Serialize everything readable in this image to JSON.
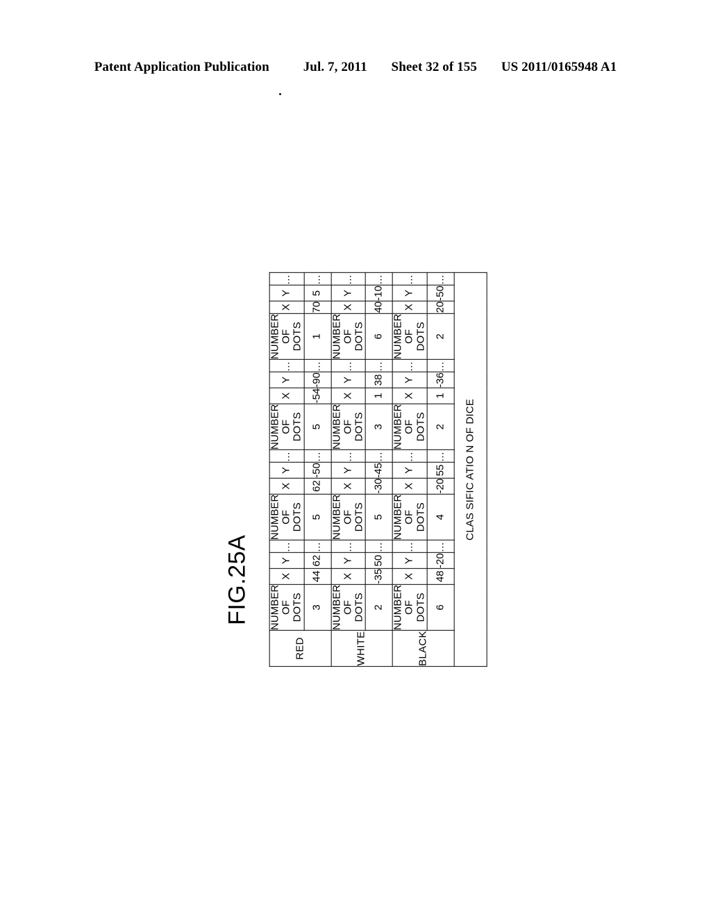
{
  "page_header": {
    "publication": "Patent Application Publication",
    "date": "Jul. 7, 2011",
    "sheet": "Sheet 32 of 155",
    "doc_number": "US 2011/0165948 A1"
  },
  "figure": {
    "label": "FIG.25A",
    "rotation_degrees": -90
  },
  "table": {
    "corner_label": "CLAS SIFIC ATIO N OF DICE",
    "corner_label_full": "CLASSIFICATION OF DICE",
    "corner_lines": [
      "CLAS",
      "SIFIC",
      "ATIO",
      "N",
      "OF",
      "DICE"
    ],
    "sub_headers": {
      "dots": "NUMBER OF DOTS",
      "dots_line1": "NUMBER",
      "dots_line2": "OF DOTS",
      "x": "X",
      "y": "Y"
    },
    "ellipsis": "…",
    "row_labels": [
      "RED",
      "WHITE",
      "BLACK"
    ],
    "groups": [
      {
        "index": 1,
        "rows": [
          {
            "label": "RED",
            "dots": "3",
            "x": "44",
            "y": "62"
          },
          {
            "label": "WHITE",
            "dots": "2",
            "x": "-35",
            "y": "50"
          },
          {
            "label": "BLACK",
            "dots": "6",
            "x": "48",
            "y": "-20"
          }
        ]
      },
      {
        "index": 2,
        "rows": [
          {
            "label": "RED",
            "dots": "5",
            "x": "62",
            "y": "-50"
          },
          {
            "label": "WHITE",
            "dots": "5",
            "x": "-30",
            "y": "-45"
          },
          {
            "label": "BLACK",
            "dots": "4",
            "x": "-20",
            "y": "55"
          }
        ]
      },
      {
        "index": 3,
        "rows": [
          {
            "label": "RED",
            "dots": "5",
            "x": "-54",
            "y": "-90"
          },
          {
            "label": "WHITE",
            "dots": "3",
            "x": "1",
            "y": "38"
          },
          {
            "label": "BLACK",
            "dots": "2",
            "x": "1",
            "y": "-36"
          }
        ]
      },
      {
        "index": 4,
        "rows": [
          {
            "label": "RED",
            "dots": "1",
            "x": "70",
            "y": "5"
          },
          {
            "label": "WHITE",
            "dots": "6",
            "x": "40",
            "y": "-10"
          },
          {
            "label": "BLACK",
            "dots": "2",
            "x": "20",
            "y": "-50"
          }
        ]
      }
    ]
  }
}
